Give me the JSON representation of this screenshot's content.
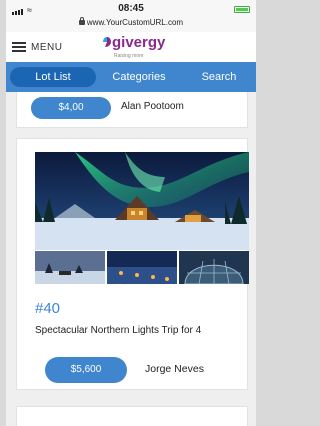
{
  "status_bar": {
    "time": "08:45",
    "url": "www.YourCustomURL.com",
    "signal_icon": "signal-bars-icon",
    "wifi_icon": "wifi-icon",
    "battery_icon": "battery-icon",
    "battery_color": "#4ccd4c"
  },
  "header": {
    "menu_label": "MENU",
    "menu_icon": "hamburger-icon",
    "logo_text": "givergy",
    "logo_tagline": "Raising more",
    "logo_color": "#8a2a8e"
  },
  "tabs": [
    {
      "label": "Lot List",
      "active": true
    },
    {
      "label": "Categories",
      "active": false
    },
    {
      "label": "Search",
      "active": false
    }
  ],
  "colors": {
    "accent": "#3f86cf",
    "active_tab": "#1b65b3"
  },
  "lots": [
    {
      "price": "$4,00",
      "bidder": "Alan Pootoom"
    },
    {
      "number": "#40",
      "title": "Spectacular Northern Lights Trip for 4",
      "price": "$5,600",
      "bidder": "Jorge Neves"
    }
  ]
}
